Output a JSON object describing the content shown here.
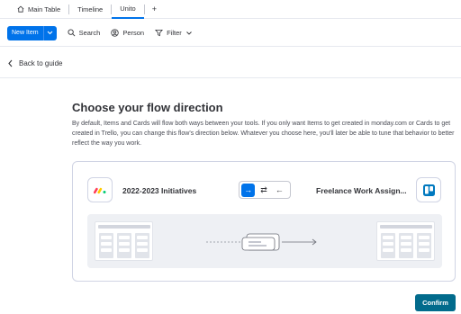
{
  "tabs": {
    "items": [
      {
        "label": "Main Table",
        "icon": "home-icon"
      },
      {
        "label": "Timeline"
      },
      {
        "label": "Unito"
      }
    ],
    "add_label": "+"
  },
  "toolbar": {
    "new_item": "New Item",
    "search": "Search",
    "person": "Person",
    "filter": "Filter"
  },
  "back": {
    "label": "Back to guide"
  },
  "main": {
    "title": "Choose your flow direction",
    "description": "By default, Items and Cards will flow both ways between your tools. If you only want Items to get created in monday.com or Cards to get created in Trello, you can change this flow's direction below. Whatever you choose here, you'll later be able to tune that behavior to better reflect the way you work."
  },
  "flow": {
    "left_name": "2022-2023 Initiatives",
    "right_name": "Freelance Work Assign...",
    "directions": [
      {
        "glyph": "→",
        "name": "one-way-right",
        "selected": true
      },
      {
        "glyph": "⇄",
        "name": "two-way",
        "selected": false
      },
      {
        "glyph": "←",
        "name": "one-way-left",
        "selected": false
      }
    ]
  },
  "confirm": "Confirm",
  "colors": {
    "accent": "#0073ea",
    "confirm": "#026b8c",
    "trello": "#0079bf"
  }
}
